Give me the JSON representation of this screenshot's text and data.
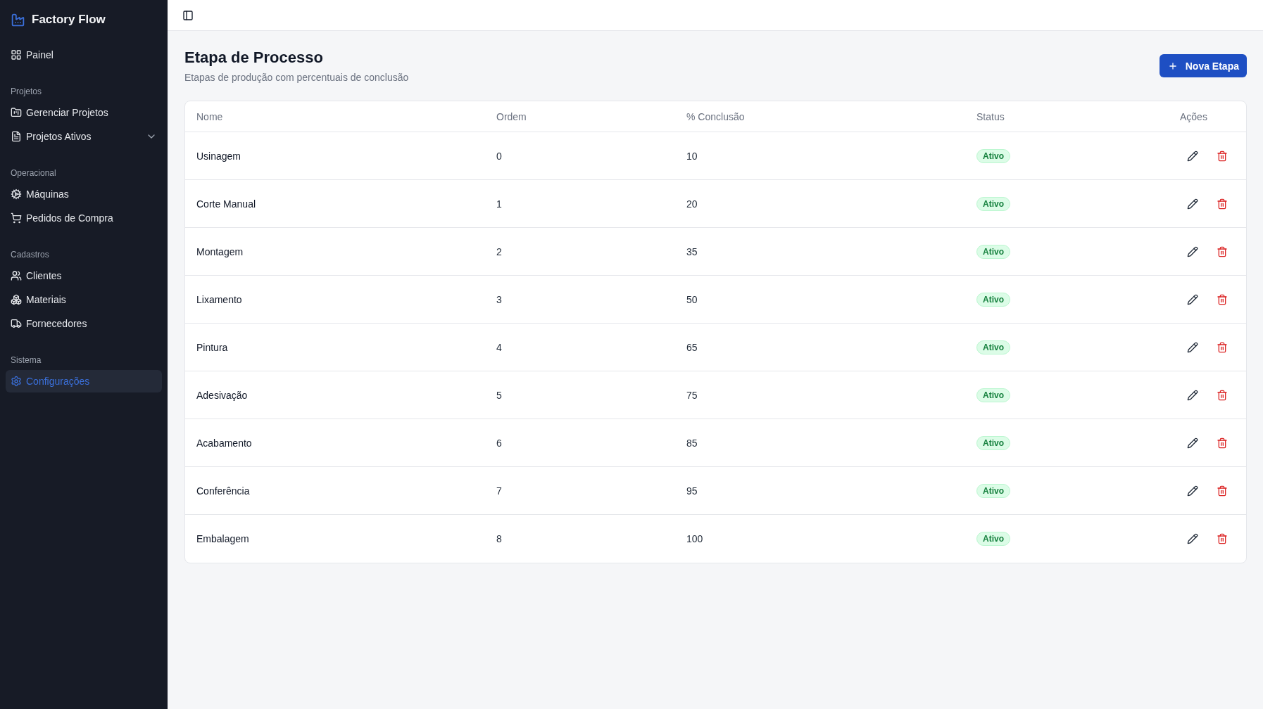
{
  "sidebar": {
    "brand": "Factory Flow",
    "groups": [
      {
        "items": [
          {
            "label": "Painel",
            "selected": false
          }
        ]
      },
      {
        "title": "Projetos",
        "items": [
          {
            "label": "Gerenciar Projetos",
            "selected": false
          },
          {
            "label": "Projetos Ativos",
            "selected": false,
            "expanded": false
          }
        ]
      },
      {
        "title": "Operacional",
        "items": [
          {
            "label": "Máquinas",
            "selected": false
          },
          {
            "label": "Pedidos de Compra",
            "selected": false
          }
        ]
      },
      {
        "title": "Cadastros",
        "items": [
          {
            "label": "Clientes",
            "selected": false
          },
          {
            "label": "Materiais",
            "selected": false
          },
          {
            "label": "Fornecedores",
            "selected": false
          }
        ]
      },
      {
        "title": "Sistema",
        "items": [
          {
            "label": "Configurações",
            "selected": true
          }
        ]
      }
    ]
  },
  "page": {
    "title": "Etapa de Processo",
    "subtitle": "Etapas de produção com percentuais de conclusão",
    "new_button": "Nova Etapa"
  },
  "table": {
    "columns": [
      "Nome",
      "Ordem",
      "% Conclusão",
      "Status",
      "Ações"
    ],
    "rows": [
      {
        "name": "Usinagem",
        "order": "0",
        "completion": "10",
        "status": {
          "label": "Ativo",
          "active": true
        }
      },
      {
        "name": "Corte Manual",
        "order": "1",
        "completion": "20",
        "status": {
          "label": "Ativo",
          "active": true
        }
      },
      {
        "name": "Montagem",
        "order": "2",
        "completion": "35",
        "status": {
          "label": "Ativo",
          "active": true
        }
      },
      {
        "name": "Lixamento",
        "order": "3",
        "completion": "50",
        "status": {
          "label": "Ativo",
          "active": true
        }
      },
      {
        "name": "Pintura",
        "order": "4",
        "completion": "65",
        "status": {
          "label": "Ativo",
          "active": true
        }
      },
      {
        "name": "Adesivação",
        "order": "5",
        "completion": "75",
        "status": {
          "label": "Ativo",
          "active": true
        }
      },
      {
        "name": "Acabamento",
        "order": "6",
        "completion": "85",
        "status": {
          "label": "Ativo",
          "active": true
        }
      },
      {
        "name": "Conferência",
        "order": "7",
        "completion": "95",
        "status": {
          "label": "Ativo",
          "active": true
        }
      },
      {
        "name": "Embalagem",
        "order": "8",
        "completion": "100",
        "status": {
          "label": "Ativo",
          "active": true
        }
      }
    ]
  }
}
